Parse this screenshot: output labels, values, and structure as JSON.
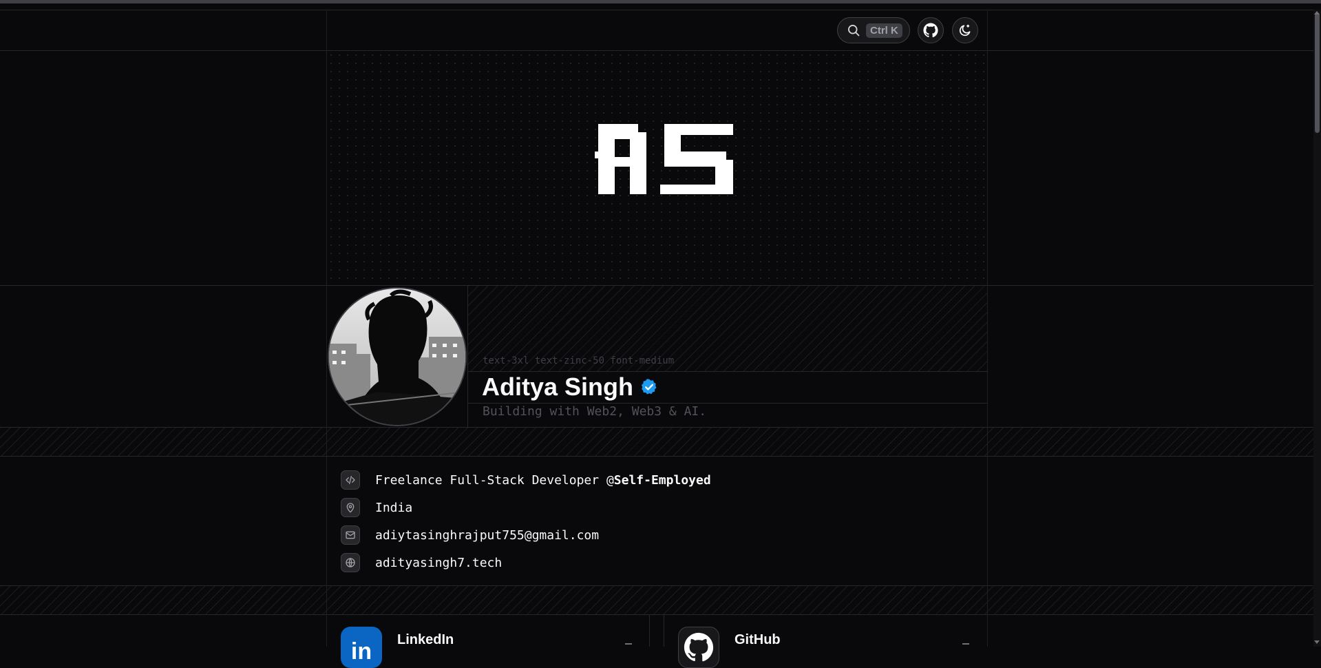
{
  "header": {
    "search_shortcut": "Ctrl K"
  },
  "hero": {
    "monogram": "AS"
  },
  "profile": {
    "class_hint": "text-3xl text-zinc-50 font-medium",
    "name": "Aditya Singh",
    "tagline": "Building with Web2, Web3 & AI."
  },
  "info": {
    "role": "Freelance Full-Stack Developer @",
    "company": "Self-Employed",
    "location": "India",
    "email": "adiytasinghrajput755@gmail.com",
    "website": "adityasingh7.tech"
  },
  "socials": [
    {
      "name": "LinkedIn",
      "color": "#0a66c2"
    },
    {
      "name": "GitHub",
      "color": "#ffffff"
    }
  ],
  "colors": {
    "background": "#09090b",
    "verified_badge": "#1d9bf0"
  }
}
